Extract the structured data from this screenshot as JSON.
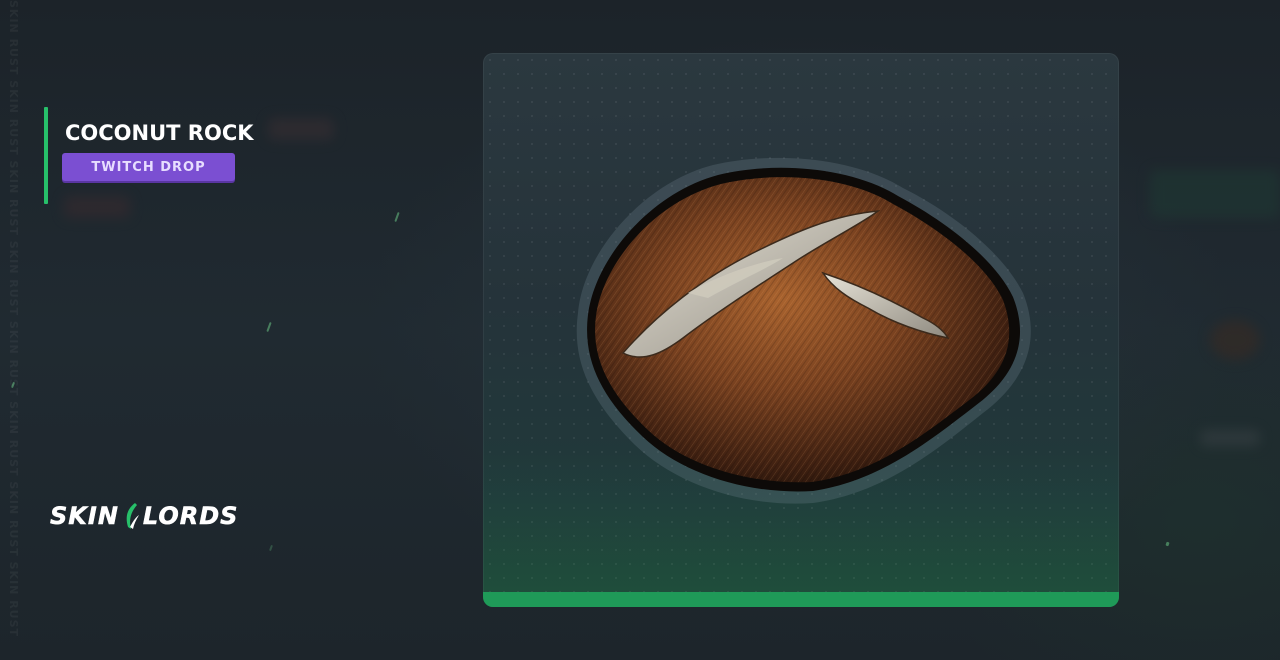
{
  "item": {
    "title": "COCONUT ROCK",
    "badge": "TWITCH DROP",
    "image_icon": "coconut-rock-skin"
  },
  "logo": {
    "left_text": "SKIN",
    "right_text": "LORDS"
  },
  "watermark": "SKIN RUST SKIN RUST SKIN RUST SKIN RUST SKIN RUST SKIN RUST SKIN RUST SKIN RUST",
  "colors": {
    "accent_green": "#27c06a",
    "badge_purple": "#7b4fd2",
    "background": "#1f272e",
    "card_bottom": "#1f9a58"
  }
}
